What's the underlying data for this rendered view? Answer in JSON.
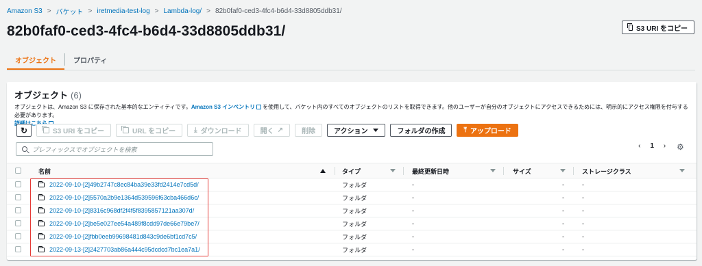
{
  "breadcrumb": [
    "Amazon S3",
    "バケット",
    "iretmedia-test-log",
    "Lambda-log/",
    "82b0faf0-ced3-4fc4-b6d4-33d8805ddb31/"
  ],
  "page_title": "82b0faf0-ced3-4fc4-b6d4-33d8805ddb31/",
  "copy_uri_label": "S3 URI をコピー",
  "tabs": [
    "オブジェクト",
    "プロパティ"
  ],
  "panel": {
    "title": "オブジェクト",
    "count": "(6)",
    "desc_prefix": "オブジェクトは、Amazon S3 に保存された基本的なエンティティです。",
    "desc_link": "Amazon S3 インベントリ",
    "desc_suffix": "を使用して、バケット内のすべてのオブジェクトのリストを取得できます。他のユーザーが自分のオブジェクトにアクセスできるためには、明示的にアクセス権限を付与する必要があります。",
    "desc_more": "詳細はこちら"
  },
  "toolbar": {
    "copy_s3_uri": "S3 URI をコピー",
    "copy_url": "URL をコピー",
    "download": "ダウンロード",
    "open": "開く",
    "delete": "削除",
    "actions": "アクション",
    "create_folder": "フォルダの作成",
    "upload": "アップロード"
  },
  "search_placeholder": "プレフィックスでオブジェクトを検索",
  "pager": {
    "page": "1"
  },
  "columns": [
    "名前",
    "タイプ",
    "最終更新日時",
    "サイズ",
    "ストレージクラス"
  ],
  "rows": [
    {
      "name": "2022-09-10-[2]49b2747c8ec84ba39e33fd2414e7cd5d/",
      "type": "フォルダ",
      "modified": "-",
      "size": "-",
      "storage": "-"
    },
    {
      "name": "2022-09-10-[2]5570a2b9e1364d539596f63cba466d6c/",
      "type": "フォルダ",
      "modified": "-",
      "size": "-",
      "storage": "-"
    },
    {
      "name": "2022-09-10-[2]8316c968df2f4f5f8395857121aa307d/",
      "type": "フォルダ",
      "modified": "-",
      "size": "-",
      "storage": "-"
    },
    {
      "name": "2022-09-10-[2]be5e027ee54a489f8cdd97de66e79be7/",
      "type": "フォルダ",
      "modified": "-",
      "size": "-",
      "storage": "-"
    },
    {
      "name": "2022-09-10-[2]fbb0eeb99698481d843c9de6bf1cd7c5/",
      "type": "フォルダ",
      "modified": "-",
      "size": "-",
      "storage": "-"
    },
    {
      "name": "2022-09-13-[2]2427703ab86a444c95dcdcd7bc1ea7a1/",
      "type": "フォルダ",
      "modified": "-",
      "size": "-",
      "storage": "-"
    }
  ],
  "colors": {
    "accent": "#ec7211",
    "link": "#0073bb",
    "highlight": "#e53935"
  }
}
